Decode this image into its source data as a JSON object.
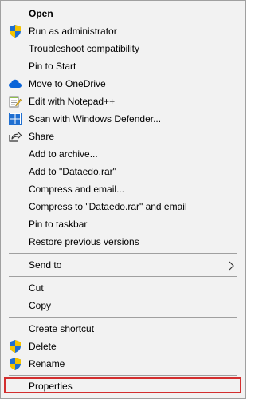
{
  "menu": {
    "items": [
      {
        "label": "Open",
        "icon": null
      },
      {
        "label": "Run as administrator",
        "icon": "shield-icon"
      },
      {
        "label": "Troubleshoot compatibility",
        "icon": null
      },
      {
        "label": "Pin to Start",
        "icon": null
      },
      {
        "label": "Move to OneDrive",
        "icon": "onedrive-cloud-icon"
      },
      {
        "label": "Edit with Notepad++",
        "icon": "notepad-plus-plus-icon"
      },
      {
        "label": "Scan with Windows Defender...",
        "icon": "windows-defender-icon"
      },
      {
        "label": "Share",
        "icon": "share-icon"
      },
      {
        "label": "Add to archive...",
        "icon": null
      },
      {
        "label": "Add to \"Dataedo.rar\"",
        "icon": null
      },
      {
        "label": "Compress and email...",
        "icon": null
      },
      {
        "label": "Compress to \"Dataedo.rar\" and email",
        "icon": null
      },
      {
        "label": "Pin to taskbar",
        "icon": null
      },
      {
        "label": "Restore previous versions",
        "icon": null
      },
      {
        "label": "Send to",
        "icon": null
      },
      {
        "label": "Cut",
        "icon": null
      },
      {
        "label": "Copy",
        "icon": null
      },
      {
        "label": "Create shortcut",
        "icon": null
      },
      {
        "label": "Delete",
        "icon": "shield-icon"
      },
      {
        "label": "Rename",
        "icon": "shield-icon"
      },
      {
        "label": "Properties",
        "icon": null
      }
    ]
  },
  "colors": {
    "menu_background": "#f2f2f2",
    "separator": "#a0a0a0",
    "highlight_border": "#d32f2f",
    "onedrive_blue": "#0a64d8"
  }
}
